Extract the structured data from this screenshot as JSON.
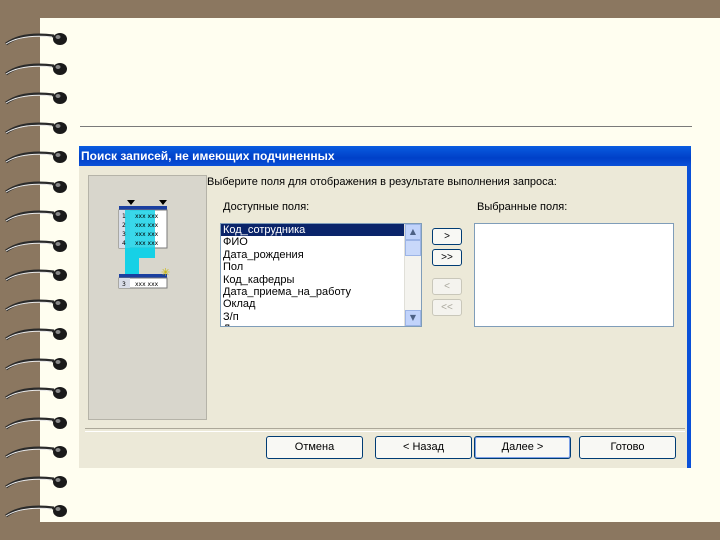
{
  "wizard": {
    "title": "Поиск записей, не имеющих подчиненных",
    "instruction": "Выберите поля для отображения в результате выполнения запроса:",
    "available_label": "Доступные поля:",
    "selected_label": "Выбранные поля:",
    "available_fields": [
      "Код_сотрудника",
      "ФИО",
      "Дата_рождения",
      "Пол",
      "Код_кафедры",
      "Дата_приема_на_работу",
      "Оклад",
      "З/п",
      "Должность"
    ],
    "selected_fields": [],
    "move_buttons": {
      "add_one": ">",
      "add_all": ">>",
      "remove_one": "<",
      "remove_all": "<<"
    },
    "footer_buttons": {
      "cancel": "Отмена",
      "back": "< Назад",
      "next": "Далее >",
      "finish": "Готово"
    },
    "illustration": {
      "rows_top": [
        "1",
        "2",
        "3",
        "4"
      ],
      "row_bottom": "3",
      "cell_text": "xxx"
    }
  }
}
